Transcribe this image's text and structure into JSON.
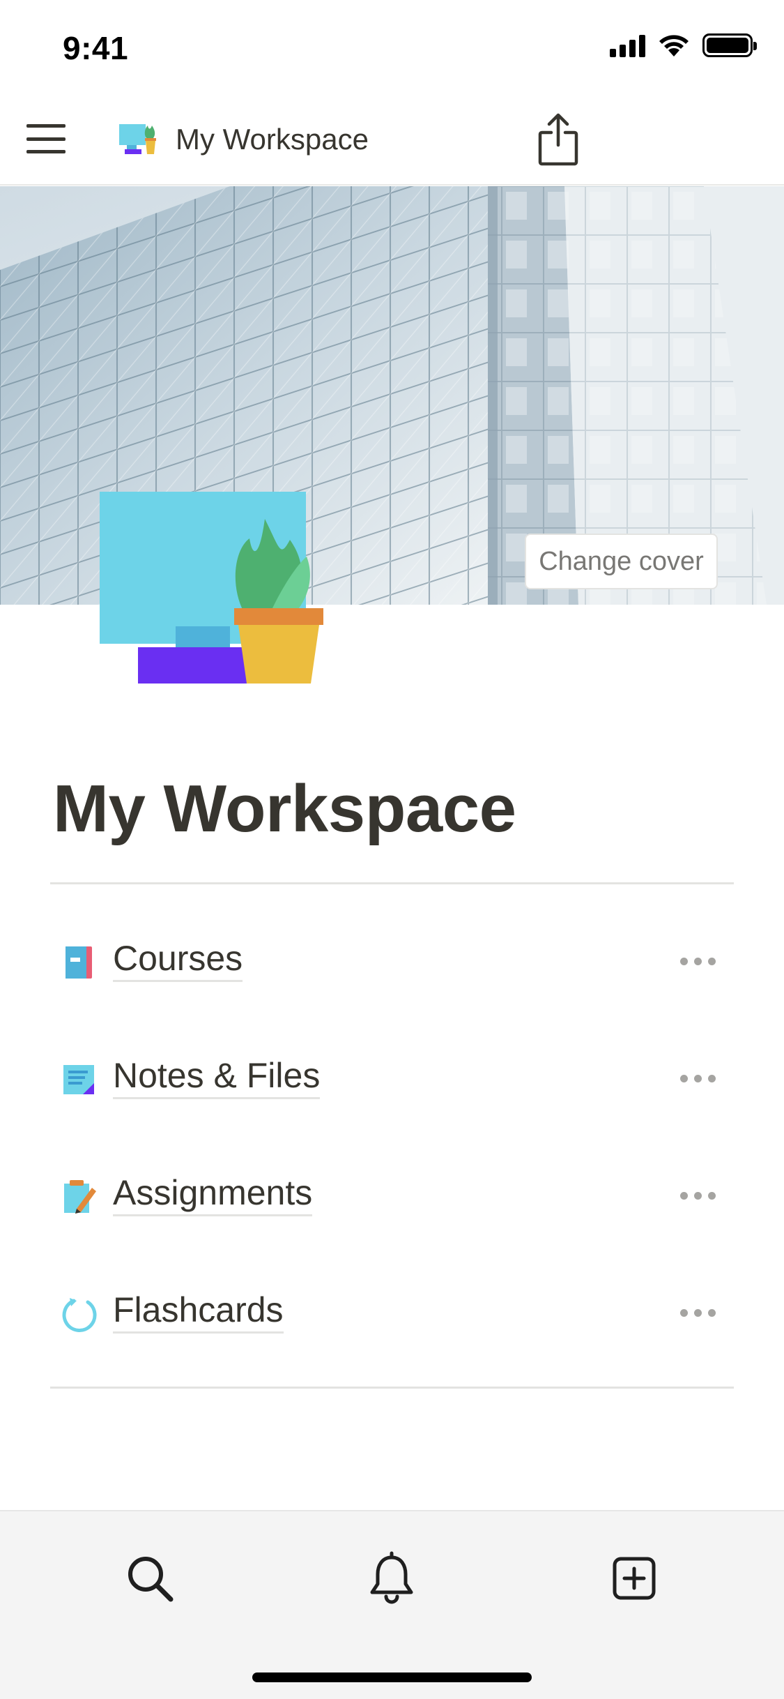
{
  "status_bar": {
    "time": "9:41"
  },
  "nav": {
    "title": "My Workspace",
    "menu_icon": "hamburger-menu-icon",
    "share_icon": "share-icon"
  },
  "cover": {
    "change_cover_label": "Change cover"
  },
  "page": {
    "title": "My Workspace",
    "icon": "computer-plant-icon"
  },
  "subpages": [
    {
      "label": "Courses",
      "icon": "book-icon"
    },
    {
      "label": "Notes & Files",
      "icon": "note-icon"
    },
    {
      "label": "Assignments",
      "icon": "clipboard-pencil-icon"
    },
    {
      "label": "Flashcards",
      "icon": "refresh-circle-icon"
    }
  ],
  "bottom_bar": {
    "tabs": [
      "search-icon",
      "bell-icon",
      "add-page-icon"
    ]
  },
  "colors": {
    "text": "#37352f",
    "muted": "#787774",
    "monitor_blue": "#6dd3e8",
    "stand_purple": "#6a2ff2",
    "pot_yellow": "#ecbd3e",
    "plant_green": "#4eb070"
  }
}
